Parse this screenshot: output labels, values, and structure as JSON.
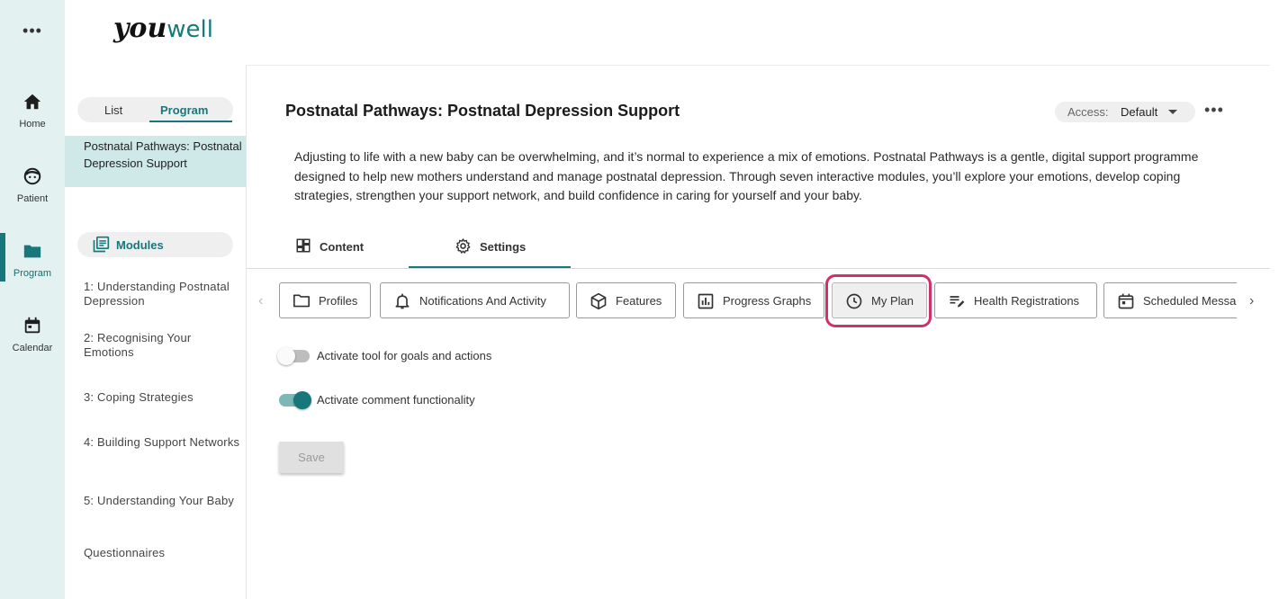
{
  "rail": {
    "more": "•••",
    "items": [
      {
        "label": "Home",
        "icon": "home-icon"
      },
      {
        "label": "Patient",
        "icon": "patient-face-icon"
      },
      {
        "label": "Program",
        "icon": "folder-icon"
      },
      {
        "label": "Calendar",
        "icon": "calendar-icon"
      }
    ],
    "active": "Program"
  },
  "logo": {
    "part1": "you",
    "part2": "well"
  },
  "sidebar": {
    "segment": {
      "list": "List",
      "program": "Program",
      "selected": "Program"
    },
    "selected_program": "Postnatal Pathways: Postnatal Depression Support",
    "modules_label": "Modules",
    "modules": [
      "1: Understanding Postnatal Depression",
      "2: Recognising Your Emotions",
      "3: Coping Strategies",
      "4: Building Support Networks",
      "5: Understanding Your Baby"
    ],
    "questionnaires": "Questionnaires"
  },
  "main": {
    "title": "Postnatal Pathways: Postnatal Depression Support",
    "access": {
      "label": "Access:",
      "value": "Default"
    },
    "description": "Adjusting to life with a new baby can be overwhelming, and it’s normal to experience a mix of emotions. Postnatal Pathways is a gentle, digital support programme designed to help new mothers understand and manage postnatal depression. Through seven interactive modules, you’ll explore your emotions, develop coping strategies, strengthen your support network, and build confidence in caring for yourself and your baby.",
    "tabs": [
      {
        "label": "Content",
        "icon": "grid-icon"
      },
      {
        "label": "Settings",
        "icon": "gear-icon"
      }
    ],
    "active_tab": "Settings",
    "chips": [
      {
        "label": "Profiles",
        "icon": "folder-outline-icon"
      },
      {
        "label": "Notifications And Activity",
        "icon": "bell-icon"
      },
      {
        "label": "Features",
        "icon": "cube-icon"
      },
      {
        "label": "Progress Graphs",
        "icon": "bar-chart-icon"
      },
      {
        "label": "My Plan",
        "icon": "clock-icon"
      },
      {
        "label": "Health Registrations",
        "icon": "edit-list-icon"
      },
      {
        "label": "Scheduled Messages",
        "icon": "calendar-outline-icon"
      }
    ],
    "active_chip": "My Plan",
    "toggles": [
      {
        "label": "Activate tool for goals and actions",
        "on": false
      },
      {
        "label": "Activate comment functionality",
        "on": true
      }
    ],
    "save_label": "Save",
    "accent": "#17777a",
    "highlight_color": "#d0306a"
  }
}
